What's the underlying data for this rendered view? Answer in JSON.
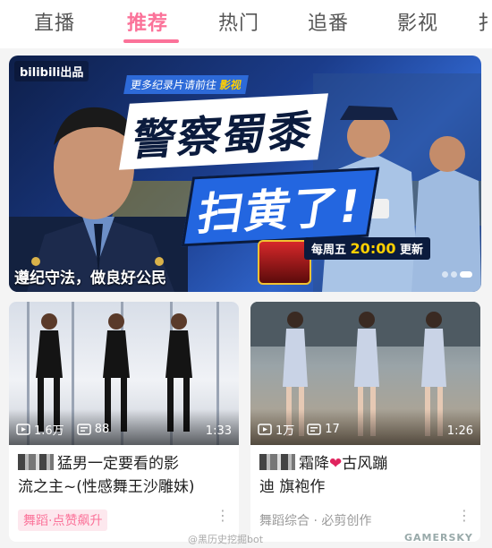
{
  "tabs": [
    {
      "label": "直播",
      "active": false
    },
    {
      "label": "推荐",
      "active": true
    },
    {
      "label": "热门",
      "active": false
    },
    {
      "label": "追番",
      "active": false
    },
    {
      "label": "影视",
      "active": false
    },
    {
      "label": "扌",
      "active": false
    }
  ],
  "banner": {
    "brand": "bilibili出品",
    "topline_prefix": "更多纪录片请前往",
    "topline_strong": "影视",
    "title_line1": "警察蜀黍",
    "title_line2": "扫黄了!",
    "schedule_prefix": "每周五",
    "schedule_time": "20:00",
    "schedule_suffix": "更新",
    "caption": "遵纪守法，做良好公民"
  },
  "cards": [
    {
      "views": "1.6万",
      "danmaku": "88",
      "duration": "1:33",
      "title_part1": "猛男一定要看的影",
      "title_part2": "流之主~(性感舞王沙雕妹)",
      "tag": "舞蹈·点赞飙升"
    },
    {
      "views": "1万",
      "danmaku": "17",
      "duration": "1:26",
      "title_part1": "霜降",
      "title_heart": "❤",
      "title_part2": "古风蹦",
      "title_part3": "迪 旗袍作",
      "tag": "舞蹈综合 · 必剪创作"
    }
  ],
  "watermarks": {
    "weibo": "@黑历史挖掘bot",
    "site": "GAMERSKY"
  },
  "colors": {
    "accent": "#fb7299",
    "banner_blue": "#2366e0",
    "banner_yellow": "#ffd000"
  }
}
